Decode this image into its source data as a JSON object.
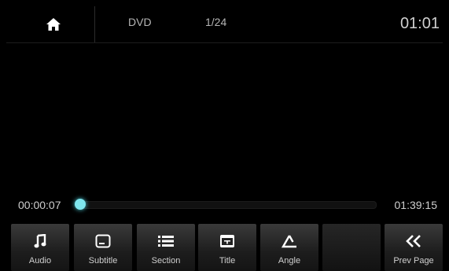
{
  "header": {
    "home_icon": "home-icon",
    "source": "DVD",
    "track": "1/24",
    "clock": "01:01"
  },
  "progress": {
    "elapsed": "00:00:07",
    "total": "01:39:15",
    "fraction": 0.001,
    "accent_color": "#7fe6ee"
  },
  "controls": [
    {
      "label": "Audio",
      "icon": "music-note-icon"
    },
    {
      "label": "Subtitle",
      "icon": "subtitle-icon"
    },
    {
      "label": "Section",
      "icon": "list-icon"
    },
    {
      "label": "Title",
      "icon": "title-icon"
    },
    {
      "label": "Angle",
      "icon": "angle-icon"
    },
    {
      "label": "",
      "icon": ""
    },
    {
      "label": "Prev Page",
      "icon": "double-chevron-left-icon"
    }
  ]
}
